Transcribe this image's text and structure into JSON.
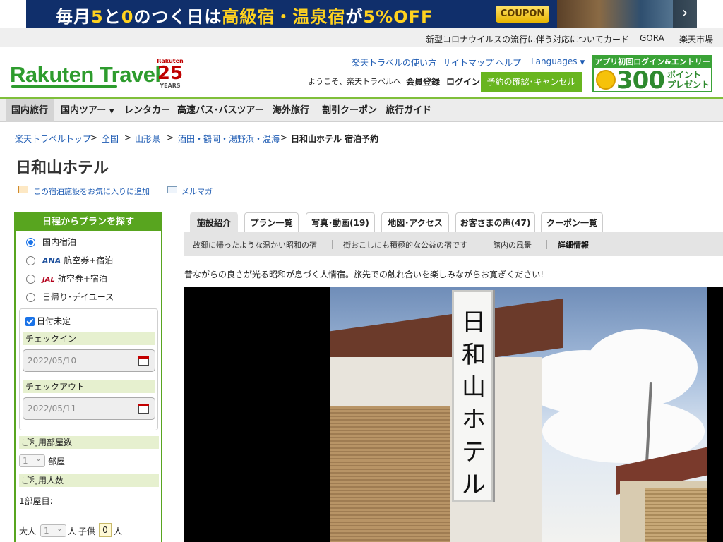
{
  "banner": {
    "text_a": "毎月",
    "num_5": "5",
    "text_to": "と",
    "num_0": "0",
    "text_b": "のつく日は",
    "text_c": "高級宿・温泉宿",
    "text_ga": "が",
    "text_off": "5%OFF",
    "coupon_label": "COUPON"
  },
  "utility": {
    "links": [
      "新型コロナウイルスの流行に伴う対応について",
      "カード",
      "GORA",
      "楽天市場"
    ]
  },
  "header": {
    "logo_text": "Rakuten Travel",
    "anniv_brand": "Rakuten",
    "anniv_number": "25",
    "anniv_years": "YEARS",
    "nav_links": [
      "楽天トラベルの使い方",
      "サイトマップ",
      "ヘルプ",
      "Languages"
    ],
    "welcome": "ようこそ、楽天トラベルへ",
    "register": "会員登録",
    "login": "ログイン",
    "reserve_button": "予約の確認･キャンセル",
    "app_promo_title": "アプリ初回ログイン&エントリーで",
    "app_promo_points": "300",
    "app_promo_unit_line1": "ポイント",
    "app_promo_unit_line2": "プレゼント"
  },
  "gnav": {
    "items": [
      "国内旅行",
      "国内ツアー",
      "レンタカー",
      "高速バス･バスツアー",
      "海外旅行",
      "割引クーポン",
      "旅行ガイド"
    ]
  },
  "breadcrumb": {
    "items": [
      "楽天トラベルトップ",
      "全国",
      "山形県",
      "酒田・鶴岡・湯野浜・温海",
      "日和山ホテル 宿泊予約"
    ],
    "separator": ">"
  },
  "hotel": {
    "name": "日和山ホテル",
    "favorite_link": "この宿泊施設をお気に入りに追加",
    "mail_link": "メルマガ",
    "catchphrase": "昔ながらの良さが光る昭和が息づく人情宿。旅先での触れ合いを楽しみながらお寛ぎください!",
    "sign_text": "日和山ホテル"
  },
  "sidebar": {
    "title": "日程からプランを探す",
    "radio_options": [
      "国内宿泊",
      "航空券+宿泊",
      "航空券+宿泊",
      "日帰り･デイユース"
    ],
    "ana_label": "ANA",
    "jal_label": "JAL",
    "date_undecided": "日付未定",
    "checkin_label": "チェックイン",
    "checkin_value": "2022/05/10",
    "checkout_label": "チェックアウト",
    "checkout_value": "2022/05/11",
    "rooms_label": "ご利用部屋数",
    "rooms_value": "1",
    "rooms_unit": "部屋",
    "guests_label": "ご利用人数",
    "room1_label": "1部屋目:",
    "adult_label": "大人",
    "adult_value": "1",
    "person_unit": "人",
    "child_label": "子供",
    "child_value": "0"
  },
  "tabs": {
    "items": [
      "施設紹介",
      "プラン一覧",
      "写真･動画(19)",
      "地図･アクセス",
      "お客さまの声(47)",
      "クーポン一覧"
    ]
  },
  "subtabs": {
    "items": [
      "故郷に帰ったような温かい昭和の宿",
      "街おこしにも積極的な公益の宿です",
      "館内の風景",
      "詳細情報"
    ]
  }
}
